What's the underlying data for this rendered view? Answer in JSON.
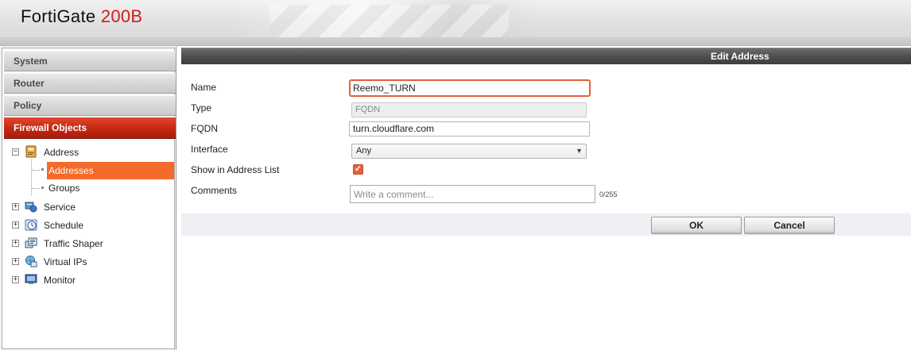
{
  "header": {
    "brand_name": "FortiGate",
    "model": "200B"
  },
  "sidebar": {
    "menus": [
      {
        "label": "System"
      },
      {
        "label": "Router"
      },
      {
        "label": "Policy"
      },
      {
        "label": "Firewall Objects",
        "active": true
      }
    ],
    "tree": {
      "address": {
        "label": "Address",
        "icon": "address-book-icon",
        "expander": "−"
      },
      "addresses": {
        "label": "Addresses"
      },
      "groups": {
        "label": "Groups"
      },
      "service": {
        "label": "Service",
        "icon": "service-icon",
        "expander": "+"
      },
      "schedule": {
        "label": "Schedule",
        "icon": "clock-icon",
        "expander": "+"
      },
      "traffic_shaper": {
        "label": "Traffic Shaper",
        "icon": "traffic-shaper-icon",
        "expander": "+"
      },
      "virtual_ips": {
        "label": "Virtual IPs",
        "icon": "globe-icon",
        "expander": "+"
      },
      "monitor": {
        "label": "Monitor",
        "icon": "monitor-icon",
        "expander": "+"
      }
    },
    "colors": {
      "active_menu": "#c72a14",
      "selected_item": "#f26b2a"
    }
  },
  "dialog": {
    "title": "Edit Address",
    "fields": {
      "name": {
        "label": "Name",
        "value": "Reemo_TURN"
      },
      "type": {
        "label": "Type",
        "value": "FQDN"
      },
      "fqdn": {
        "label": "FQDN",
        "value": "turn.cloudflare.com"
      },
      "interface": {
        "label": "Interface",
        "value": "Any"
      },
      "show_in_list": {
        "label": "Show in Address List",
        "checked": true
      },
      "comments": {
        "label": "Comments",
        "placeholder": "Write a comment...",
        "counter": "0/255"
      }
    },
    "buttons": {
      "ok": "OK",
      "cancel": "Cancel"
    },
    "colors": {
      "focus_border": "#e2623b",
      "checkbox": "#e2623b"
    }
  }
}
